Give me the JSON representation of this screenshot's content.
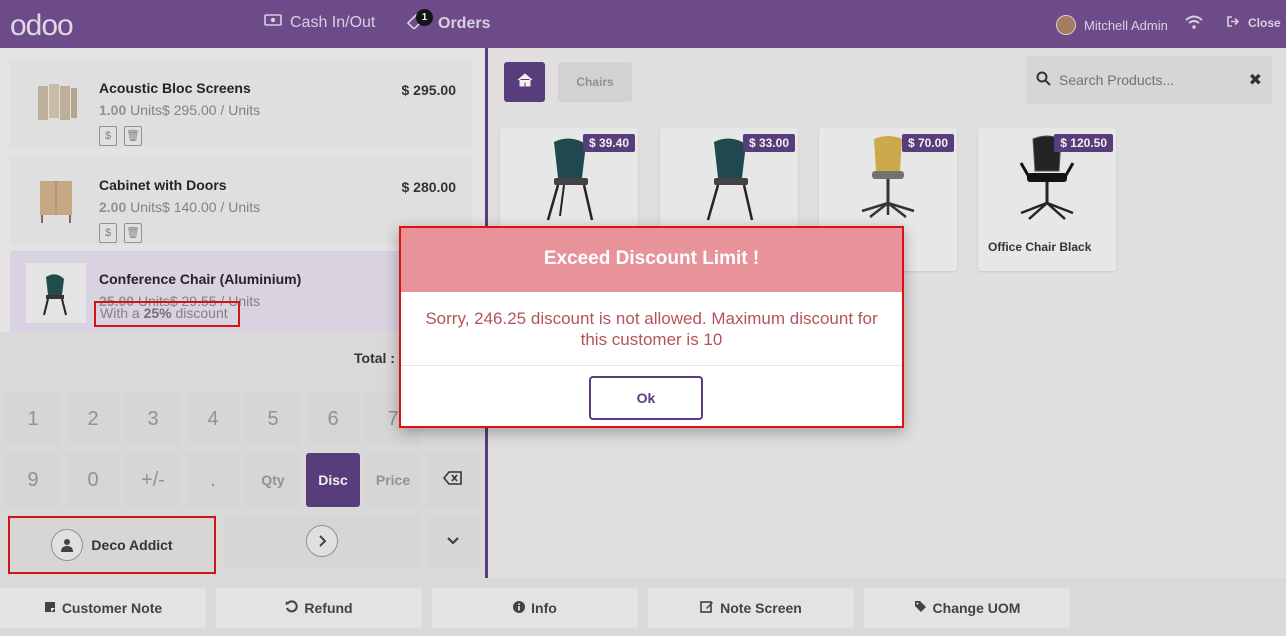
{
  "topbar": {
    "logo": "odoo",
    "cash_label": "Cash In/Out",
    "orders_label": "Orders",
    "orders_count": "1",
    "user_name": "Mitchell Admin",
    "close_label": "Close"
  },
  "order": {
    "lines": [
      {
        "name": "Acoustic Bloc Screens",
        "price": "$ 295.00",
        "qty": "1.00",
        "unit_text": "Units$ 295.00 / Units"
      },
      {
        "name": "Cabinet with Doors",
        "price": "$ 280.00",
        "qty": "2.00",
        "unit_text": "Units$ 140.00 / Units"
      },
      {
        "name": "Conference Chair (Aluminium)",
        "qty": "25.00",
        "unit_text": "Units$ 29.55 / Units",
        "discount_prefix": "With a",
        "discount_value": "25%",
        "discount_suffix": "discount"
      }
    ],
    "total_label": "Total :"
  },
  "numpad": {
    "keys_row1": [
      "1",
      "2",
      "3",
      "4",
      "5",
      "6",
      "7"
    ],
    "keys_row2": [
      "9",
      "0",
      "+/-",
      ".",
      "Qty",
      "Disc",
      "Price"
    ],
    "customer": "Deco Addict"
  },
  "products": {
    "breadcrumb": "Chairs",
    "search_placeholder": "Search Products...",
    "items": [
      {
        "price": "$ 39.40",
        "name": ""
      },
      {
        "price": "$ 33.00",
        "name": ""
      },
      {
        "price": "$ 70.00",
        "name": ""
      },
      {
        "price": "$ 120.50",
        "name": "Office Chair Black"
      }
    ]
  },
  "control_buttons": [
    "Customer Note",
    "Refund",
    "Info",
    "Note Screen",
    "Change UOM"
  ],
  "dialog": {
    "title": "Exceed Discount Limit !",
    "body": "Sorry, 246.25 discount is not allowed. Maximum discount for this customer is 10",
    "ok_label": "Ok"
  },
  "colors": {
    "brand": "#714b8f",
    "accent": "#5a3d80",
    "dialog_header": "#e8929a",
    "highlight": "#e01010"
  }
}
